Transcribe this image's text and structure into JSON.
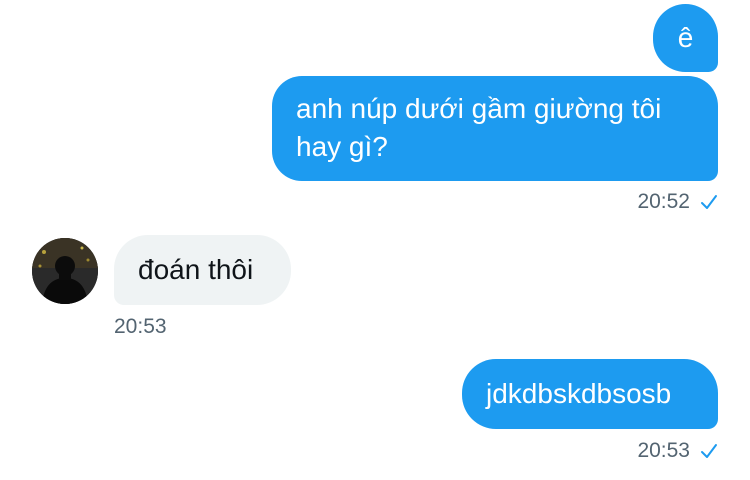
{
  "messages": [
    {
      "text": "ê",
      "direction": "outgoing"
    },
    {
      "text": "anh núp dưới gầm giường tôi hay gì?",
      "direction": "outgoing",
      "time": "20:52",
      "status_icon": "read-check-icon"
    },
    {
      "text": "đoán thôi",
      "direction": "incoming",
      "time": "20:53",
      "avatar_icon": "contact-avatar"
    },
    {
      "text": "jdkdbskdbsosb",
      "direction": "outgoing",
      "time": "20:53",
      "status_icon": "read-check-icon"
    }
  ],
  "colors": {
    "outgoing_bubble": "#1d9bf0",
    "incoming_bubble": "#eff3f4",
    "timestamp": "#536471"
  }
}
